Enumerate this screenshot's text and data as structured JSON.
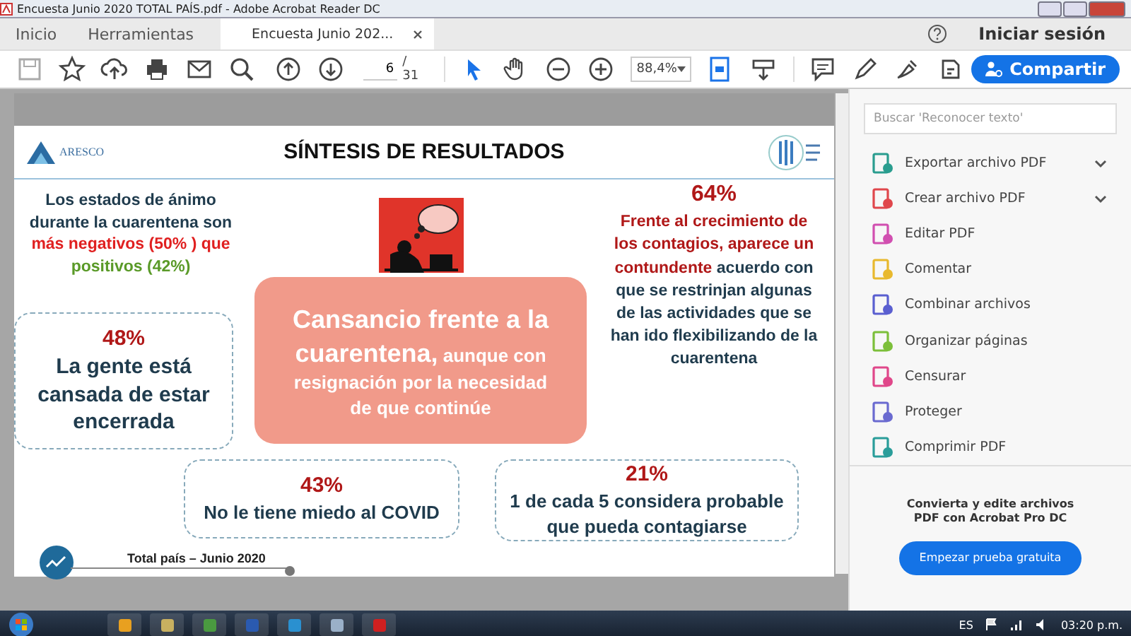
{
  "window": {
    "title": "Encuesta Junio 2020 TOTAL PAÍS.pdf - Adobe Acrobat Reader DC"
  },
  "tabs": [
    {
      "label": "Inicio",
      "selected": false
    },
    {
      "label": "Herramientas",
      "selected": false
    },
    {
      "label": "Encuesta Junio 202...",
      "selected": true
    }
  ],
  "header": {
    "sign_in": "Iniciar sesión"
  },
  "toolbar": {
    "tools_left": [
      {
        "kind": "save"
      },
      {
        "kind": "star"
      },
      {
        "kind": "upload"
      },
      {
        "kind": "print"
      },
      {
        "kind": "mail"
      },
      {
        "kind": "zoom"
      }
    ],
    "page_current": "6",
    "page_total": "/ 31",
    "zoom": "88,4%",
    "tools_right": [
      {
        "kind": "comment"
      },
      {
        "kind": "pen"
      },
      {
        "kind": "sign"
      },
      {
        "kind": "stamp"
      }
    ],
    "share": "Compartir"
  },
  "slide": {
    "title": "SÍNTESIS DE RESULTADOS",
    "logo_text": "ARESCO",
    "mood": [
      {
        "text": "Los estados de ánimo durante la cuarentena son ",
        "kind": "plain"
      },
      {
        "text": "más negativos (50% ) que ",
        "kind": "red"
      },
      {
        "text": "positivos (42%)",
        "kind": "green"
      }
    ],
    "center": [
      {
        "text": "Cansancio frente a la cuarentena,",
        "kind": "big"
      },
      {
        "text": " aunque con resignación por la necesidad de que continúe",
        "kind": "plain"
      }
    ],
    "right_percent": "64%",
    "right_text": [
      {
        "text": "Frente al crecimiento de los contagios, aparece un contundente",
        "kind": "red"
      },
      {
        "text": " acuerdo con que se restrinjan algunas de las actividades que se han ido flexibilizando de la cuarentena",
        "kind": "plain"
      }
    ],
    "boxes": [
      {
        "percent": "48%",
        "text": "La gente está cansada de estar encerrada"
      },
      {
        "percent": "43%",
        "text": "No le tiene miedo al COVID"
      },
      {
        "percent": "21%",
        "text": "1 de cada 5 considera probable que pueda contagiarse"
      }
    ],
    "footer": "Total país – Junio 2020"
  },
  "sidebar": {
    "search": {
      "placeholder": "Buscar 'Reconocer texto'"
    },
    "items": [
      {
        "label": "Exportar archivo PDF",
        "has_menu": true,
        "color": "#2a9d8f"
      },
      {
        "label": "Crear archivo PDF",
        "has_menu": true,
        "color": "#e0474c"
      },
      {
        "label": "Editar PDF",
        "has_menu": false,
        "color": "#d14fb0"
      },
      {
        "label": "Comentar",
        "has_menu": false,
        "color": "#e8b92e"
      },
      {
        "label": "Combinar archivos",
        "has_menu": false,
        "color": "#5a5fd0"
      },
      {
        "label": "Organizar páginas",
        "has_menu": false,
        "color": "#7cbf3a"
      },
      {
        "label": "Censurar",
        "has_menu": false,
        "color": "#e0478a"
      },
      {
        "label": "Proteger",
        "has_menu": false,
        "color": "#6a6ad0"
      },
      {
        "label": "Comprimir PDF",
        "has_menu": false,
        "color": "#2a9d9a"
      }
    ],
    "promo": "Convierta y edite archivos PDF con Acrobat Pro DC",
    "trial": "Empezar prueba gratuita"
  },
  "taskbar": {
    "language": "ES",
    "time": "03:20 p.m."
  }
}
